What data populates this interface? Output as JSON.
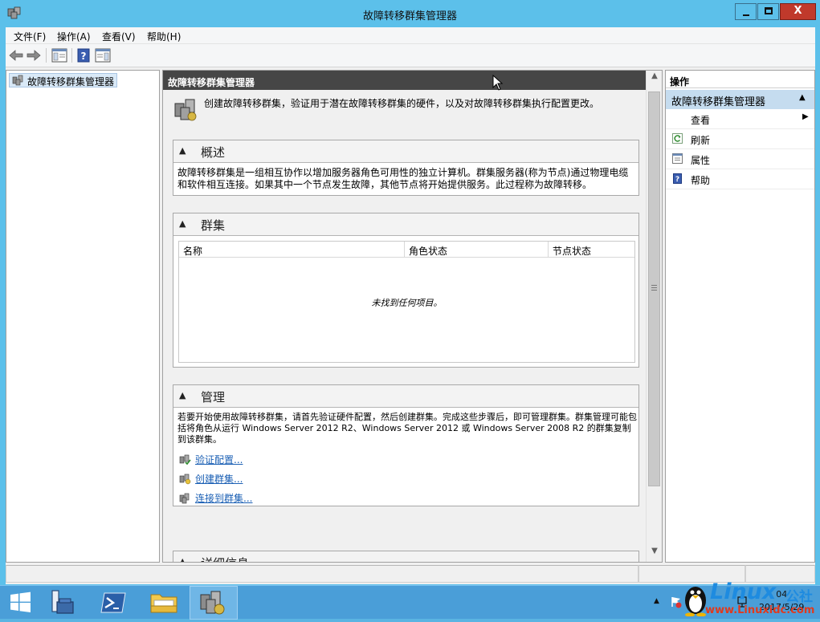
{
  "window": {
    "title": "故障转移群集管理器",
    "controls": {
      "minimize": "_",
      "maximize": "□",
      "close": "X"
    }
  },
  "menubar": {
    "items": [
      "文件(F)",
      "操作(A)",
      "查看(V)",
      "帮助(H)"
    ]
  },
  "toolbar": {
    "buttons": [
      "back-arrow-icon",
      "forward-arrow-icon",
      "show-hide-console-tree-icon",
      "help-icon",
      "show-hide-action-pane-icon"
    ]
  },
  "tree": {
    "root_label": "故障转移群集管理器"
  },
  "center": {
    "header": "故障转移群集管理器",
    "intro": "创建故障转移群集，验证用于潜在故障转移群集的硬件，以及对故障转移群集执行配置更改。",
    "overview": {
      "title": "概述",
      "text": "故障转移群集是一组相互协作以增加服务器角色可用性的独立计算机。群集服务器(称为节点)通过物理电缆和软件相互连接。如果其中一个节点发生故障，其他节点将开始提供服务。此过程称为故障转移。"
    },
    "clusters": {
      "title": "群集",
      "columns": [
        "名称",
        "角色状态",
        "节点状态"
      ],
      "empty_message": "未找到任何项目。"
    },
    "manage": {
      "title": "管理",
      "text": "若要开始使用故障转移群集，请首先验证硬件配置，然后创建群集。完成这些步骤后，即可管理群集。群集管理可能包括将角色从运行 Windows Server 2012 R2、Windows Server 2012 或 Windows Server 2008 R2 的群集复制到该群集。",
      "links": [
        "验证配置...",
        "创建群集...",
        "连接到群集..."
      ]
    },
    "details": {
      "title": "详细信息"
    }
  },
  "actions": {
    "header": "操作",
    "section_title": "故障转移群集管理器",
    "items": [
      {
        "label": "查看",
        "icon": "none",
        "submenu": true
      },
      {
        "label": "刷新",
        "icon": "refresh-icon"
      },
      {
        "label": "属性",
        "icon": "properties-icon"
      },
      {
        "label": "帮助",
        "icon": "help-icon"
      }
    ]
  },
  "taskbar": {
    "apps": [
      "start-icon",
      "server-manager-icon",
      "powershell-icon",
      "file-explorer-icon",
      "failover-cluster-manager-icon"
    ],
    "clock_time": "04",
    "clock_date": "2017/5/29"
  },
  "watermark": {
    "brand": "Linux",
    "suffix": "公社",
    "url": "www.Linuxidc.com"
  },
  "colors": {
    "titlebar": "#5cc0ea",
    "header_dark": "#464646",
    "action_section": "#c5dcef",
    "link": "#1a5fb4",
    "taskbar": "#4a9ed8"
  }
}
